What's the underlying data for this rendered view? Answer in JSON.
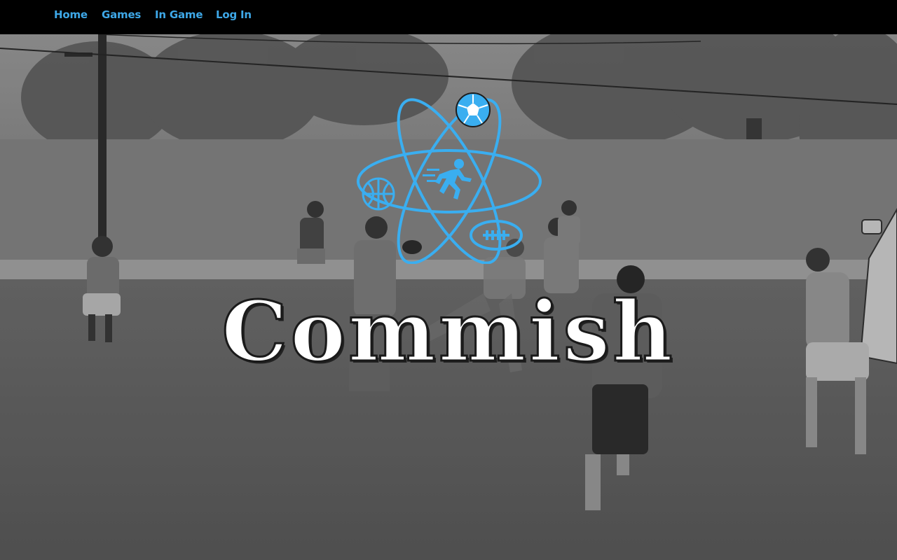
{
  "nav": {
    "items": [
      {
        "label": "Home"
      },
      {
        "label": "Games"
      },
      {
        "label": "In Game"
      },
      {
        "label": "Log In"
      }
    ]
  },
  "hero": {
    "title": "Commish",
    "logo_icons": [
      "soccer-ball-icon",
      "basketball-icon",
      "football-icon",
      "runner-icon",
      "atom-orbits-icon"
    ]
  },
  "colors": {
    "accent": "#3ea8e8",
    "nav_bg": "#000000"
  }
}
